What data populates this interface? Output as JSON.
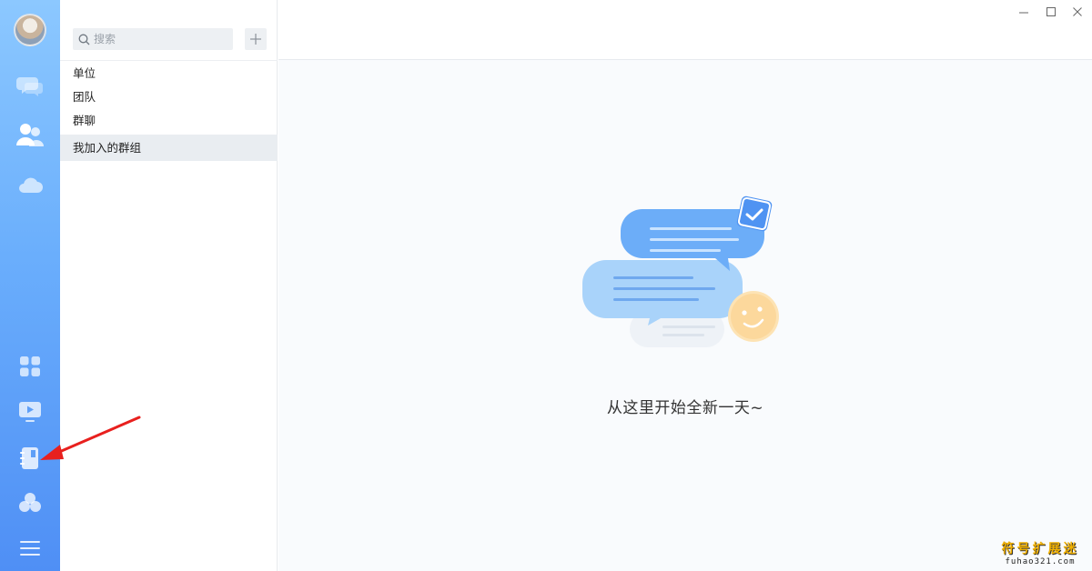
{
  "sidebar": {
    "icons": [
      "chat-icon",
      "contacts-icon",
      "cloud-icon",
      "apps-grid-icon",
      "video-icon",
      "notebook-icon",
      "clover-icon",
      "menu-icon"
    ]
  },
  "list_panel": {
    "search_placeholder": "搜索",
    "items": [
      {
        "label": "单位"
      },
      {
        "label": "团队"
      },
      {
        "label": "群聊"
      },
      {
        "label": "我加入的群组",
        "active": true
      }
    ]
  },
  "main": {
    "empty_message": "从这里开始全新一天~"
  },
  "watermark": {
    "title": "符号扩展迷",
    "url": "fuhao321.com"
  },
  "colors": {
    "rail_top": "#8cc8ff",
    "rail_bottom": "#4f8ff5",
    "active_item_bg": "#e9edf1",
    "accent_arrow": "#e8201e"
  }
}
